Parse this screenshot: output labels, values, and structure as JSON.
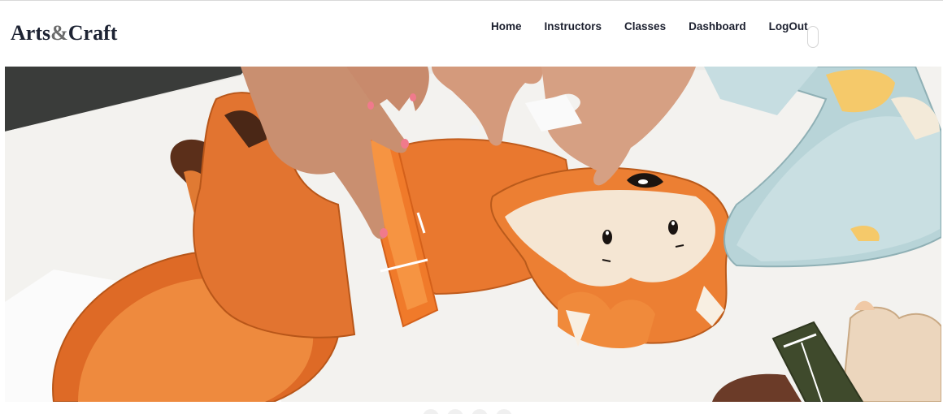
{
  "brand": {
    "part1": "Arts",
    "amp": "&",
    "part2": "Craft"
  },
  "nav": {
    "items": [
      {
        "label": "Home"
      },
      {
        "label": "Instructors"
      },
      {
        "label": "Classes"
      },
      {
        "label": "Dashboard"
      },
      {
        "label": "LogOut"
      }
    ]
  },
  "theme_toggle": {
    "icon": "toggle-icon"
  },
  "hero": {
    "image": "paper-craft-fox-banner"
  },
  "colors": {
    "brand_text": "#1d2333",
    "brand_amp": "#6b6b6b",
    "nav_text": "#1b1f2e",
    "fox_orange": "#e8782c"
  }
}
